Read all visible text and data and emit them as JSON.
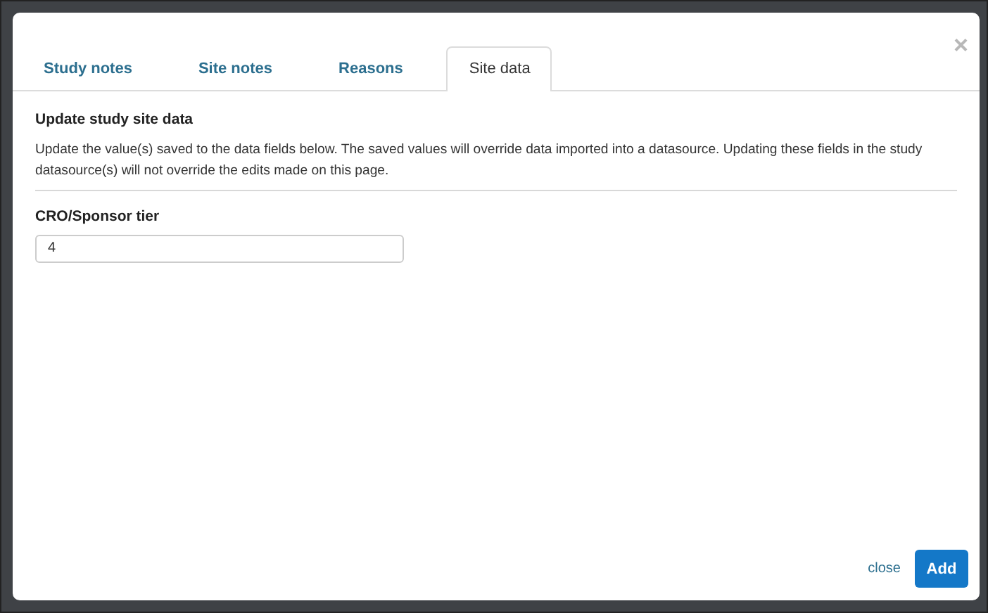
{
  "tabs": [
    {
      "label": "Study notes",
      "selected": false
    },
    {
      "label": "Site notes",
      "selected": false
    },
    {
      "label": "Reasons",
      "selected": false
    },
    {
      "label": "Site data",
      "selected": true
    }
  ],
  "close_icon": "×",
  "section": {
    "title": "Update study site data",
    "description": "Update the value(s) saved to the data fields below. The saved values will override data imported into a datasource. Updating these fields in the study datasource(s) will not override the edits made on this page."
  },
  "fields": [
    {
      "label": "CRO/Sponsor tier",
      "value": "4"
    }
  ],
  "footer": {
    "close_link": "close",
    "add_button": "Add"
  }
}
